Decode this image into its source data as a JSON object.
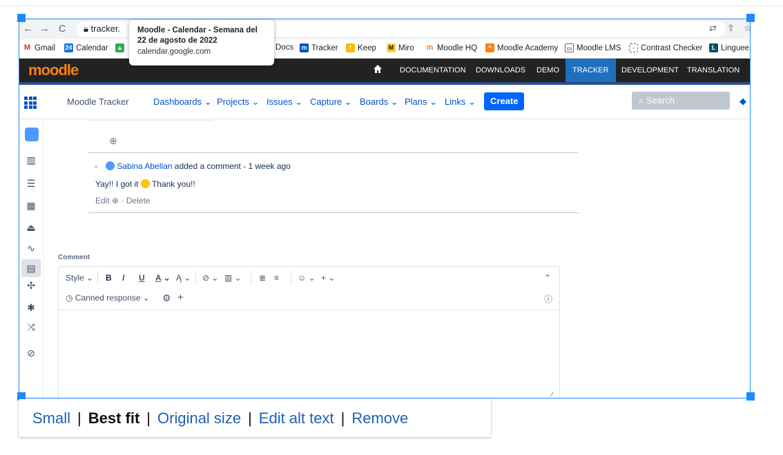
{
  "browser": {
    "url": "tracker.",
    "tooltip": {
      "title_line1": "Moodle - Calendar - Semana del",
      "title_line2": "22 de agosto de 2022",
      "url": "calendar.google.com"
    },
    "bookmarks": [
      "Gmail",
      "Calendar",
      "Docs",
      "Tracker",
      "Keep",
      "Miro",
      "Moodle HQ",
      "Moodle Academy",
      "Moodle LMS",
      "Contrast Checker",
      "Linguee"
    ]
  },
  "moodle": {
    "logo": "moodle",
    "nav": [
      "DOCUMENTATION",
      "DOWNLOADS",
      "DEMO",
      "TRACKER",
      "DEVELOPMENT",
      "TRANSLATION"
    ],
    "active": "TRACKER"
  },
  "jira": {
    "title": "Moodle Tracker",
    "menus": [
      "Dashboards ⌄",
      "Projects ⌄",
      "Issues ⌄",
      "Capture ⌄",
      "Boards ⌄",
      "Plans ⌄",
      "Links ⌄"
    ],
    "create": "Create",
    "search_placeholder": "Search"
  },
  "comment": {
    "author": "Sabina Abellan",
    "action": "added a comment - 1 week ago",
    "text_before": "Yay!! I got it",
    "text_after": "Thank you!!",
    "edit": "Edit",
    "delete": "Delete"
  },
  "editor": {
    "label": "Comment",
    "style": "Style",
    "canned": "Canned response"
  },
  "image_menu": {
    "small": "Small",
    "best_fit": "Best fit",
    "original": "Original size",
    "alt": "Edit alt text",
    "remove": "Remove",
    "separator": "|"
  },
  "colors": {
    "accent": "#0052cc",
    "selection": "#1a8cff",
    "moodle_orange": "#f98012",
    "active_tab": "#1f6fbf"
  }
}
